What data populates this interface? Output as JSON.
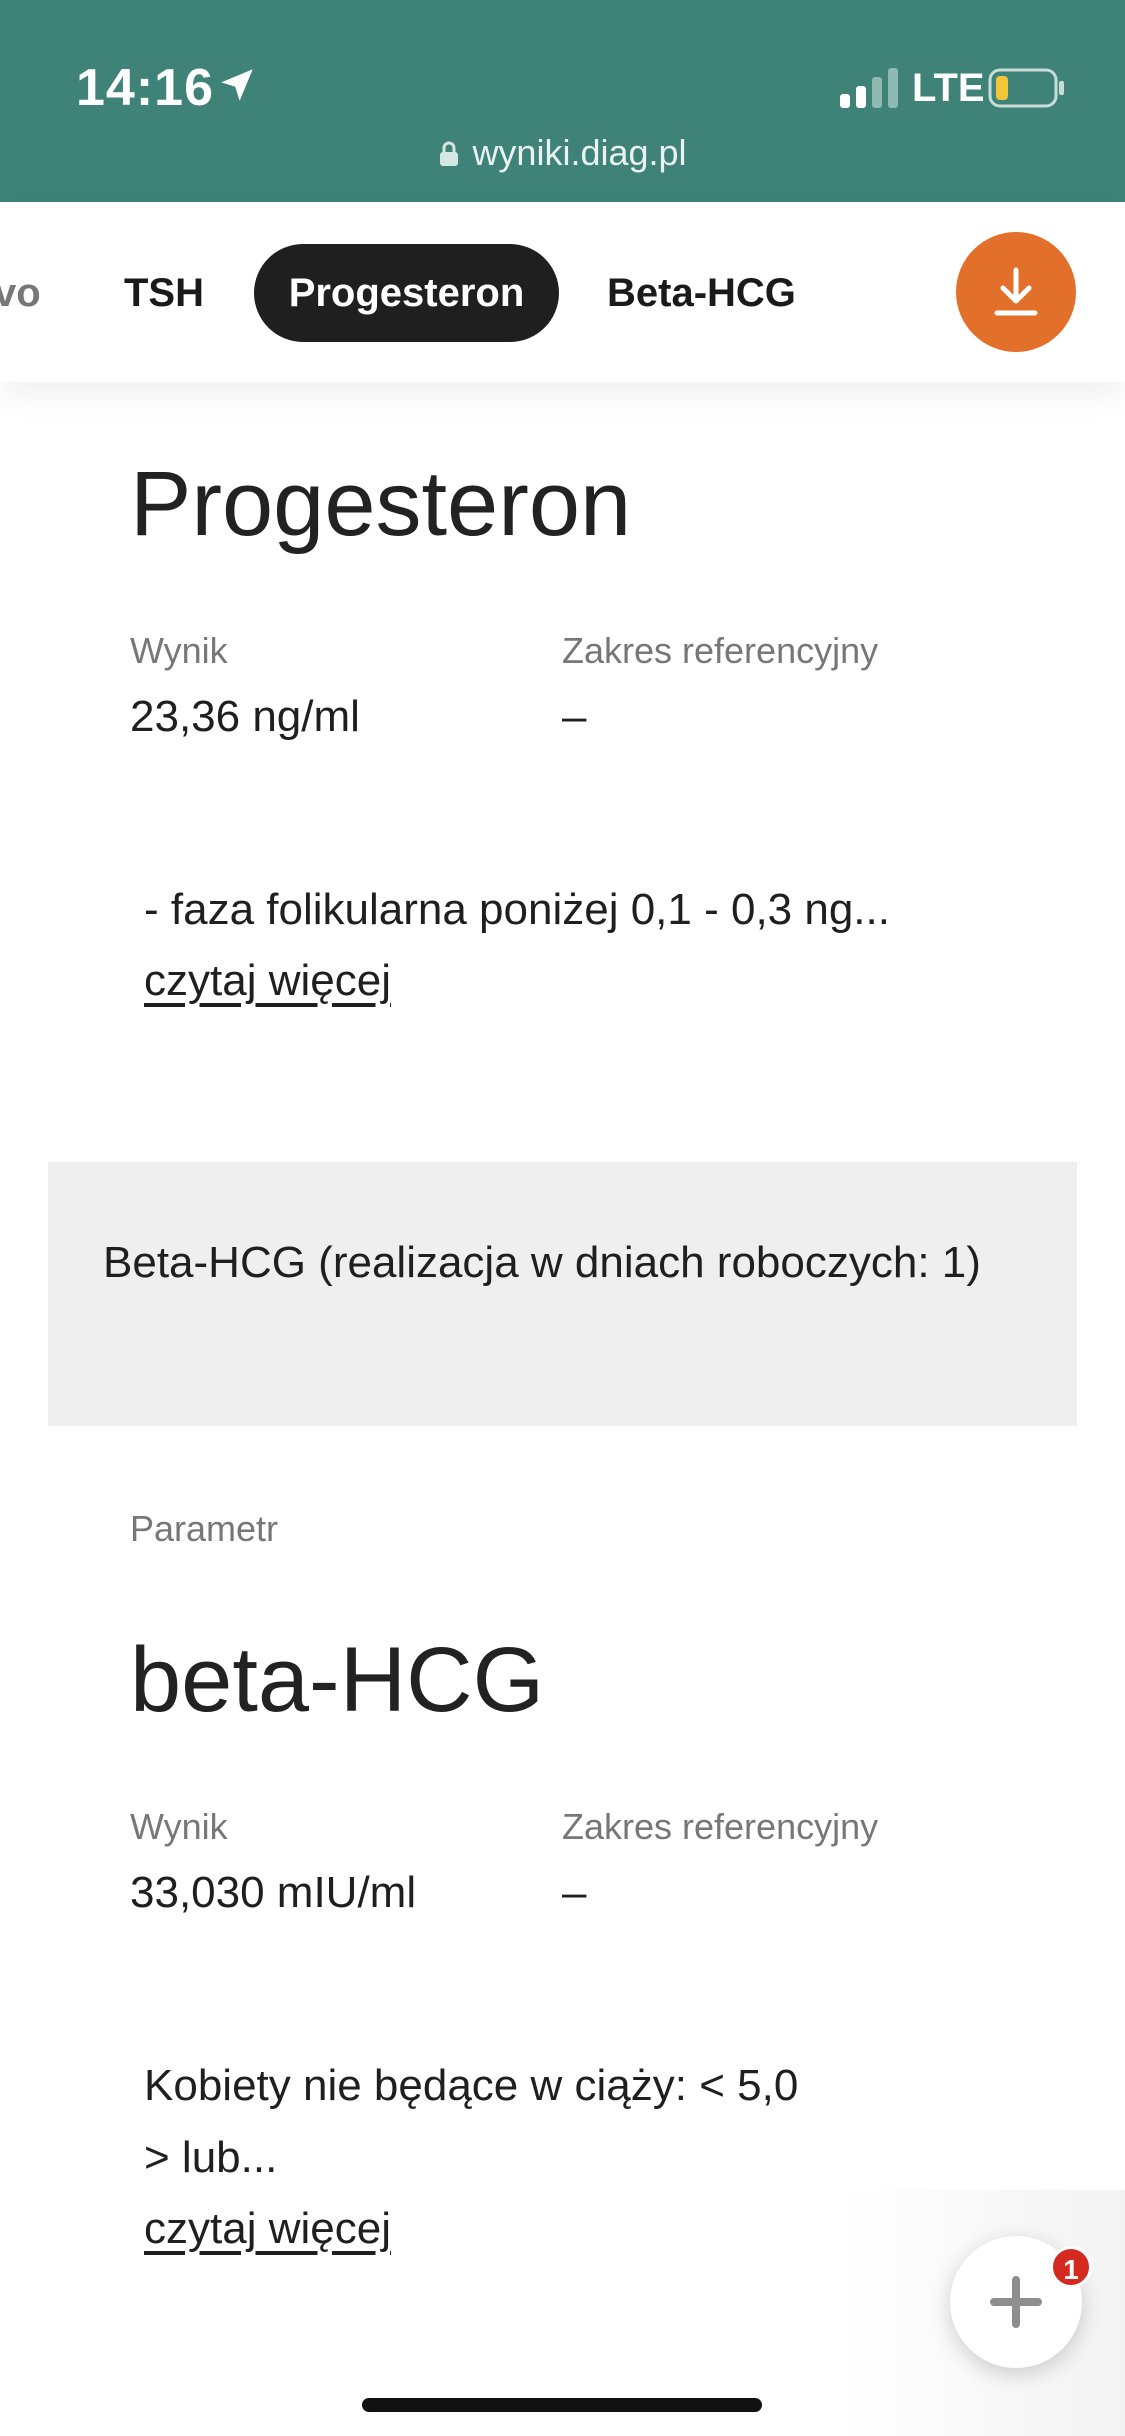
{
  "status_bar": {
    "time": "14:16",
    "network": "LTE",
    "url": "wyniki.diag.pl"
  },
  "tabs": {
    "items": [
      {
        "label": "vo"
      },
      {
        "label": "TSH"
      },
      {
        "label": "Progesteron",
        "active": true
      },
      {
        "label": "Beta-HCG"
      }
    ],
    "download_icon": "download-icon"
  },
  "progesteron": {
    "title": "Progesteron",
    "result_label": "Wynik",
    "result_value": "23,36 ng/ml",
    "range_label": "Zakres referencyjny",
    "range_value": "–",
    "description": "- faza folikularna poniżej 0,1 - 0,3 ng...",
    "read_more": "czytaj więcej"
  },
  "beta_section": {
    "header": "Beta-HCG (realizacja w dniach roboczych: 1)",
    "param_label": "Parametr",
    "title": "beta-HCG",
    "result_label": "Wynik",
    "result_value": "33,030 mIU/ml",
    "range_label": "Zakres referencyjny",
    "range_value": "–",
    "description_line1": "Kobiety nie będące w ciąży: < 5,0",
    "description_line2": "> lub...",
    "read_more": "czytaj więcej"
  },
  "fab": {
    "icon": "plus-icon",
    "badge": "1"
  },
  "colors": {
    "header_bg": "#3e8278",
    "accent": "#e2702a",
    "active_tab": "#1f1f1f",
    "badge": "#d42a1f"
  }
}
